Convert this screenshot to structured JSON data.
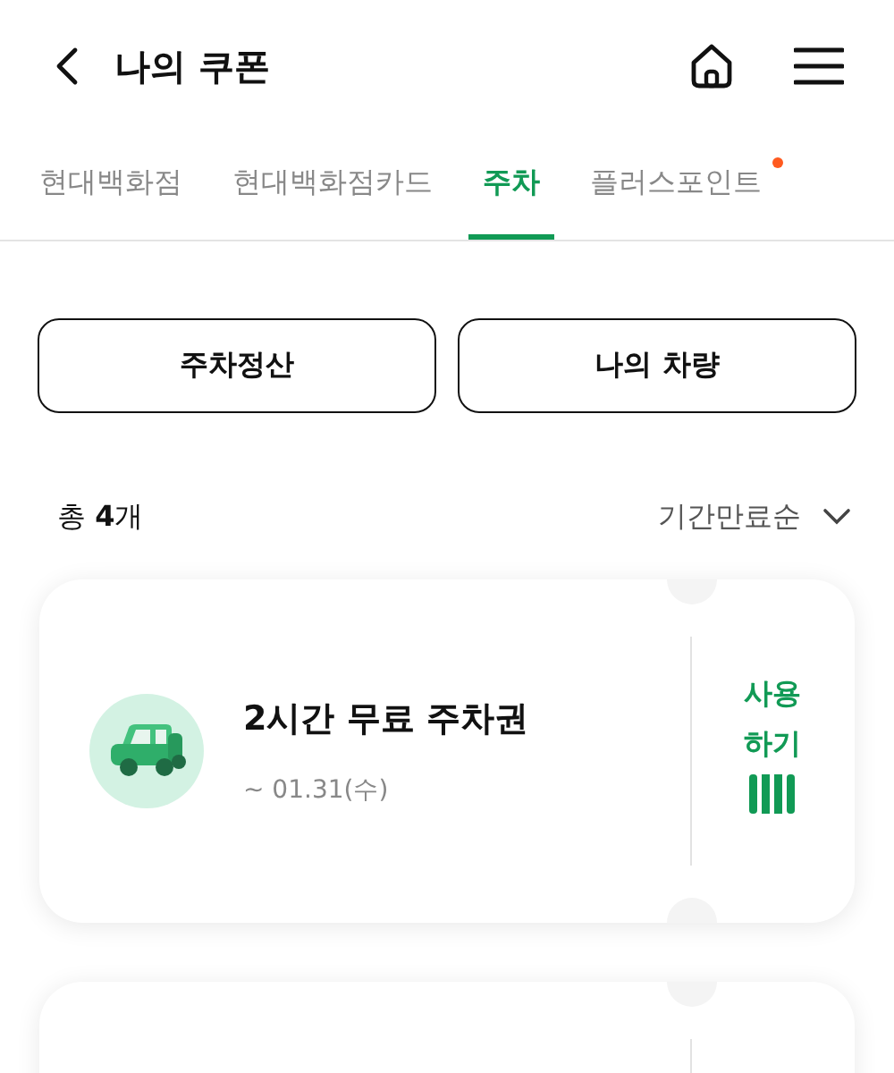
{
  "header": {
    "title": "나의 쿠폰"
  },
  "tabs": [
    {
      "label": "현대백화점",
      "selected": false,
      "has_dot": false
    },
    {
      "label": "현대백화점카드",
      "selected": false,
      "has_dot": false
    },
    {
      "label": "주차",
      "selected": true,
      "has_dot": false
    },
    {
      "label": "플러스포인트",
      "selected": false,
      "has_dot": true
    }
  ],
  "actions": [
    "주차정산",
    "나의 차량"
  ],
  "summary": {
    "count_text": "총 **4**개",
    "sort": "기간만료순"
  },
  "coupons": [
    {
      "title": "2시간 무료 주차권",
      "expiry": "~ 01.31(수)",
      "use_label": [
        "사용",
        "하기"
      ]
    }
  ],
  "more_below": true
}
